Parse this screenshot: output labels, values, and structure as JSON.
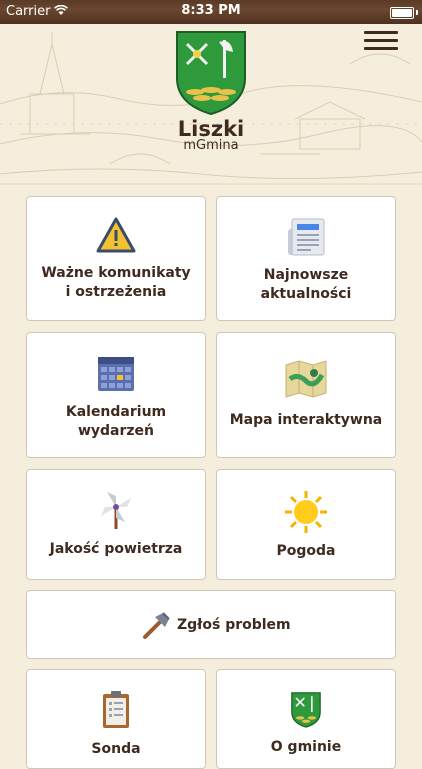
{
  "status_bar": {
    "carrier": "Carrier",
    "time": "8:33 PM"
  },
  "header": {
    "app_name": "Liszki",
    "app_subtitle": "mGmina"
  },
  "tiles": {
    "alerts": {
      "line1": "Ważne komunikaty",
      "line2": "i ostrzeżenia"
    },
    "news": {
      "line1": "Najnowsze",
      "line2": "aktualności"
    },
    "calendar": {
      "line1": "Kalendarium",
      "line2": "wydarzeń"
    },
    "map": {
      "line1": "Mapa interaktywna"
    },
    "air": {
      "line1": "Jakość powietrza"
    },
    "weather": {
      "line1": "Pogoda"
    },
    "report": {
      "line1": "Zgłoś problem"
    },
    "poll": {
      "line1": "Sonda"
    },
    "about": {
      "line1": "O gminie"
    }
  },
  "colors": {
    "text": "#3f2a1f",
    "background": "#f6eedd",
    "tile": "#ffffff",
    "warning": "#f2c230",
    "coat_green": "#2e9a3b"
  },
  "icons": [
    "warning-triangle-icon",
    "newspaper-icon",
    "calendar-icon",
    "map-icon",
    "pinwheel-icon",
    "sun-icon",
    "hammer-icon",
    "clipboard-icon",
    "coat-of-arms-icon",
    "menu-icon"
  ]
}
